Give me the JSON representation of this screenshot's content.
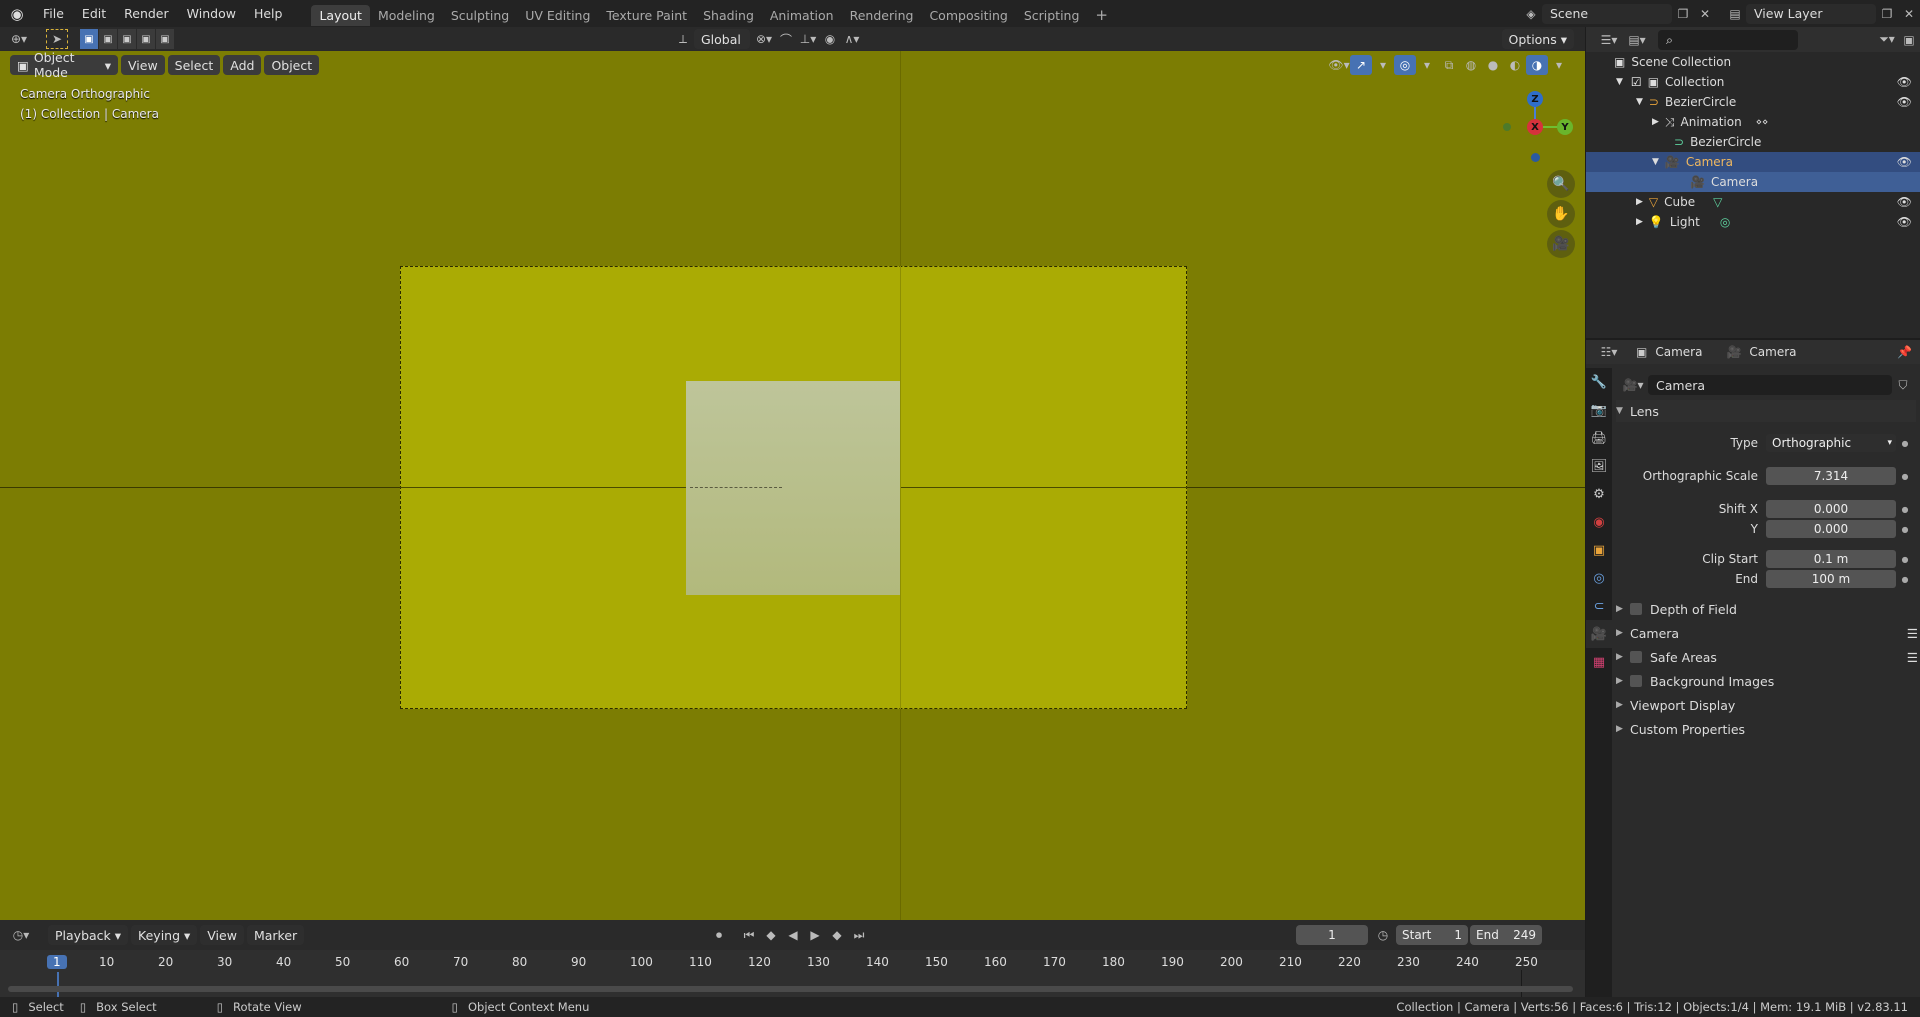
{
  "topbar": {
    "menus": [
      "File",
      "Edit",
      "Render",
      "Window",
      "Help"
    ],
    "workspaces": [
      "Layout",
      "Modeling",
      "Sculpting",
      "UV Editing",
      "Texture Paint",
      "Shading",
      "Animation",
      "Rendering",
      "Compositing",
      "Scripting"
    ],
    "active_workspace": "Layout",
    "add_tab": "+",
    "scene": "Scene",
    "view_layer": "View Layer"
  },
  "viewport": {
    "mode": "Object Mode",
    "menus": [
      "View",
      "Select",
      "Add",
      "Object"
    ],
    "transform_orientation": "Global",
    "options": "Options",
    "overlay_title": "Camera Orthographic",
    "overlay_subtitle": "(1) Collection | Camera",
    "gizmo": {
      "z": "Z",
      "x": "X",
      "y": "Y"
    }
  },
  "outliner": {
    "search_placeholder": "",
    "items": [
      {
        "label": "Scene Collection",
        "icon": "scene-collection-icon"
      },
      {
        "label": "Collection",
        "icon": "collection-icon"
      },
      {
        "label": "BezierCircle",
        "icon": "curve-icon"
      },
      {
        "label": "Animation",
        "icon": "animation-icon"
      },
      {
        "label": "BezierCircle",
        "icon": "curve-data-icon"
      },
      {
        "label": "Camera",
        "icon": "camera-icon"
      },
      {
        "label": "Camera",
        "icon": "camera-data-icon"
      },
      {
        "label": "Cube",
        "icon": "mesh-icon"
      },
      {
        "label": "Light",
        "icon": "light-icon"
      }
    ]
  },
  "properties": {
    "breadcrumb_object": "Camera",
    "breadcrumb_data": "Camera",
    "datablock_name": "Camera",
    "lens_panel": "Lens",
    "type_label": "Type",
    "type_value": "Orthographic",
    "ortho_scale_label": "Orthographic Scale",
    "ortho_scale_value": "7.314",
    "shift_x_label": "Shift X",
    "shift_x_value": "0.000",
    "shift_y_label": "Y",
    "shift_y_value": "0.000",
    "clip_start_label": "Clip Start",
    "clip_start_value": "0.1 m",
    "clip_end_label": "End",
    "clip_end_value": "100 m",
    "panels": [
      "Depth of Field",
      "Camera",
      "Safe Areas",
      "Background Images",
      "Viewport Display",
      "Custom Properties"
    ]
  },
  "timeline": {
    "menus": [
      "Playback",
      "Keying",
      "View",
      "Marker"
    ],
    "current_frame": "1",
    "start_label": "Start",
    "start_value": "1",
    "end_label": "End",
    "end_value": "249",
    "ticks": [
      "1",
      "10",
      "20",
      "30",
      "40",
      "50",
      "60",
      "70",
      "80",
      "90",
      "100",
      "110",
      "120",
      "130",
      "140",
      "150",
      "160",
      "170",
      "180",
      "190",
      "200",
      "210",
      "220",
      "230",
      "240",
      "250"
    ]
  },
  "status": {
    "select": "Select",
    "box_select": "Box Select",
    "rotate_view": "Rotate View",
    "context_menu": "Object Context Menu",
    "stats": "Collection | Camera | Verts:56 | Faces:6 | Tris:12 | Objects:1/4 | Mem: 19.1 MiB | v2.83.11"
  },
  "colors": {
    "viewport_bg": "#7c7d03",
    "camera_frame": "#aaab04",
    "selection_blue": "#4772b3"
  }
}
